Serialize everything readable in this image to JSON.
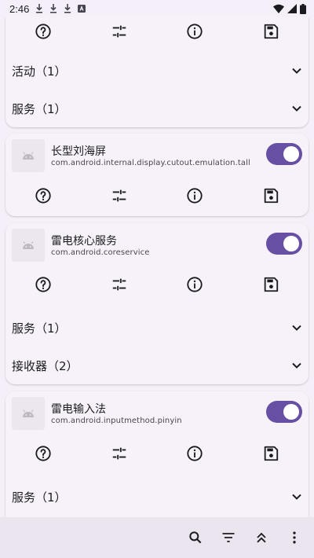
{
  "status_bar": {
    "time": "2:46",
    "left_icons": [
      "download-icon",
      "download-icon",
      "download-icon",
      "app-notification-icon"
    ],
    "right_icons": [
      "wifi-icon",
      "signal-icon",
      "battery-icon"
    ]
  },
  "action_icons": [
    "help-icon",
    "tune-icon",
    "info-icon",
    "save-icon"
  ],
  "cards": [
    {
      "partial": true,
      "sections": [
        {
          "label": "活动（1）"
        },
        {
          "label": "服务（1）"
        }
      ]
    },
    {
      "app_name": "长型刘海屏",
      "package": "com.android.internal.display.cutout.emulation.tall",
      "enabled": true,
      "sections": []
    },
    {
      "app_name": "雷电核心服务",
      "package": "com.android.coreservice",
      "enabled": true,
      "sections": [
        {
          "label": "服务（1）"
        },
        {
          "label": "接收器（2）"
        }
      ]
    },
    {
      "app_name": "雷电输入法",
      "package": "com.android.inputmethod.pinyin",
      "enabled": true,
      "sections": [
        {
          "label": "服务（1）"
        }
      ]
    }
  ],
  "bottom_bar": {
    "icons": [
      "search-icon",
      "filter-icon",
      "collapse-all-icon",
      "more-vert-icon"
    ]
  },
  "colors": {
    "accent": "#6750a4",
    "background": "#f4eff8",
    "card": "#f7f2fa",
    "bottom_bar": "#ebe5f0"
  }
}
